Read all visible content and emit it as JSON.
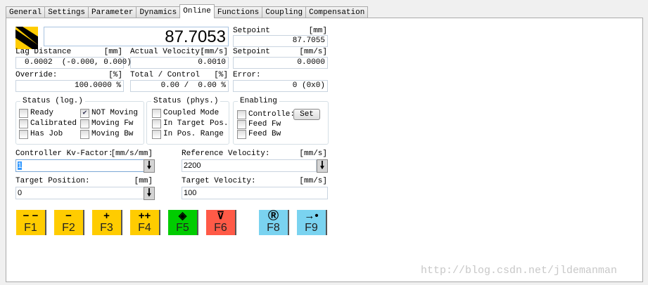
{
  "tabs": [
    "General",
    "Settings",
    "Parameter",
    "Dynamics",
    "Online",
    "Functions",
    "Coupling",
    "Compensation"
  ],
  "active_tab": "Online",
  "position_display": "87.7053",
  "setpoint_pos": {
    "label": "Setpoint",
    "unit": "[mm]",
    "value": "87.7055"
  },
  "lag": {
    "label": "Lag Distance",
    "unit": "[mm]",
    "value": "0.0002  (-0.000, 0.000)"
  },
  "actual_velocity": {
    "label": "Actual Velocity:",
    "unit": "[mm/s]",
    "value": "0.0010"
  },
  "setpoint_vel": {
    "label": "Setpoint",
    "unit": "[mm/s]",
    "value": "0.0000"
  },
  "override": {
    "label": "Override:",
    "unit": "[%]",
    "value": "100.0000 %"
  },
  "total_control": {
    "label": "Total / Control",
    "unit": "[%]",
    "value": "0.00 /  0.00 %"
  },
  "error": {
    "label": "Error:",
    "value": "0 (0x0)"
  },
  "status_log": {
    "title": "Status (log.)",
    "items": [
      {
        "label": "Ready",
        "checked": false
      },
      {
        "label": "Calibrated",
        "checked": false
      },
      {
        "label": "Has Job",
        "checked": false
      },
      {
        "label": "NOT Moving",
        "checked": true
      },
      {
        "label": "Moving Fw",
        "checked": false
      },
      {
        "label": "Moving Bw",
        "checked": false
      }
    ]
  },
  "status_phys": {
    "title": "Status (phys.)",
    "items": [
      {
        "label": "Coupled Mode",
        "checked": false
      },
      {
        "label": "In Target Pos.",
        "checked": false
      },
      {
        "label": "In Pos. Range",
        "checked": false
      }
    ]
  },
  "enabling": {
    "title": "Enabling",
    "items": [
      {
        "label": "Controlle:",
        "checked": false
      },
      {
        "label": "Feed Fw",
        "checked": false
      },
      {
        "label": "Feed Bw",
        "checked": false
      }
    ],
    "set_label": "Set"
  },
  "kv": {
    "label": "Controller Kv-Factor:",
    "unit": "[mm/s/mm]",
    "value": "1"
  },
  "ref_vel": {
    "label": "Reference Velocity:",
    "unit": "[mm/s]",
    "value": "2200"
  },
  "target_pos": {
    "label": "Target Position:",
    "unit": "[mm]",
    "value": "0"
  },
  "target_vel": {
    "label": "Target Velocity:",
    "unit": "[mm/s]",
    "value": "100"
  },
  "fkeys": [
    {
      "sym": "− −",
      "key": "F1",
      "color": "#ffcc00"
    },
    {
      "sym": "−",
      "key": "F2",
      "color": "#ffcc00"
    },
    {
      "sym": "+",
      "key": "F3",
      "color": "#ffcc00"
    },
    {
      "sym": "++",
      "key": "F4",
      "color": "#ffcc00"
    },
    {
      "sym": "◈",
      "key": "F5",
      "color": "#00cc00"
    },
    {
      "sym": "⊽",
      "key": "F6",
      "color": "#ff5a47"
    },
    {
      "sym": "Ⓡ",
      "key": "F8",
      "color": "#7ad3f0"
    },
    {
      "sym": "→•",
      "key": "F9",
      "color": "#7ad3f0"
    }
  ],
  "watermark": "http://blog.csdn.net/jldemanman"
}
